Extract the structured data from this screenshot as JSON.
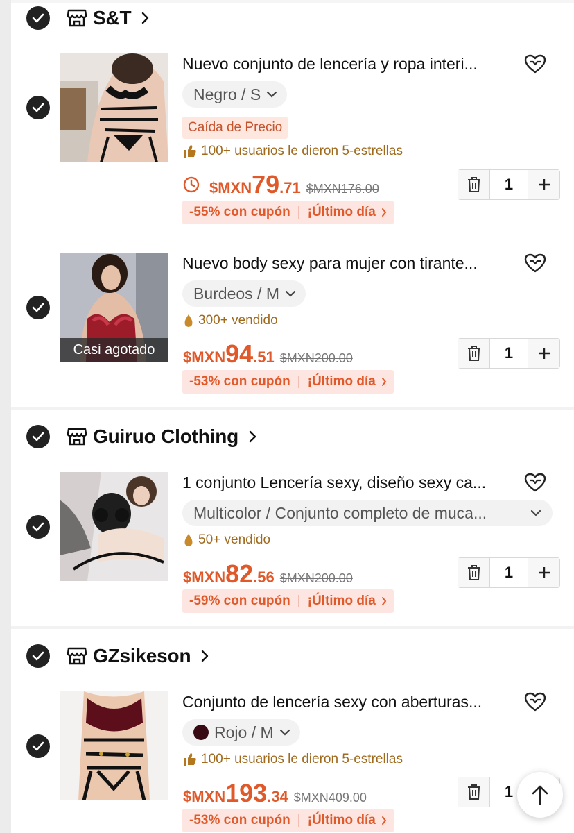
{
  "accent": "#e0592a",
  "stores": [
    {
      "name": "S&T",
      "items": [
        {
          "title": "Nuevo conjunto de lencería y ropa interi...",
          "variant": "Negro / S",
          "badge": "Caída de Precio",
          "social": "100+ usuarios le dieron 5-estrellas",
          "price_cur": "$MXN",
          "price_int": "79",
          "price_dec": ".71",
          "old_price": "$MXN176.00",
          "coupon": "-55% con cupón",
          "coupon_tag": "¡Último día",
          "qty": "1"
        },
        {
          "title": "Nuevo body sexy para mujer con tirante...",
          "variant": "Burdeos / M",
          "thumb_badge": "Casi agotado",
          "social": "300+ vendido",
          "price_cur": "$MXN",
          "price_int": "94",
          "price_dec": ".51",
          "old_price": "$MXN200.00",
          "coupon": "-53% con cupón",
          "coupon_tag": "¡Último día",
          "qty": "1"
        }
      ]
    },
    {
      "name": "Guiruo Clothing",
      "items": [
        {
          "title": "1 conjunto Lencería sexy, diseño sexy ca...",
          "variant": "Multicolor / Conjunto completo de muca...",
          "social": "50+ vendido",
          "price_cur": "$MXN",
          "price_int": "82",
          "price_dec": ".56",
          "old_price": "$MXN200.00",
          "coupon": "-59% con cupón",
          "coupon_tag": "¡Último día",
          "qty": "1"
        }
      ]
    },
    {
      "name": "GZsikeson",
      "items": [
        {
          "title": "Conjunto de lencería sexy con aberturas...",
          "variant": "Rojo / M",
          "social": "100+ usuarios le dieron 5-estrellas",
          "price_cur": "$MXN",
          "price_int": "193",
          "price_dec": ".34",
          "old_price": "$MXN409.00",
          "coupon": "-53% con cupón",
          "coupon_tag": "¡Último día",
          "qty": "1"
        }
      ]
    }
  ],
  "icons": {
    "check": "check-icon",
    "store": "store-icon",
    "heart": "heart-add-icon",
    "trash": "trash-icon",
    "plus": "plus-icon",
    "clock": "clock-icon",
    "thumbs_up": "thumbs-up-icon",
    "flame": "flame-icon",
    "back_to_top": "arrow-up-icon"
  }
}
